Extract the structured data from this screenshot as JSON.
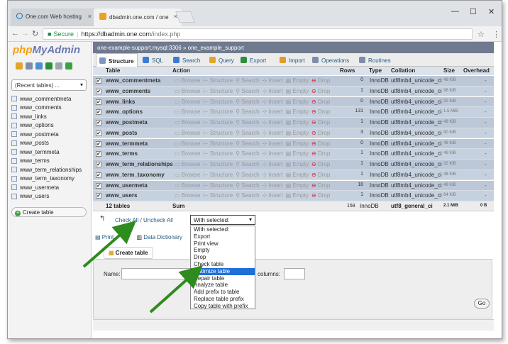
{
  "browser": {
    "tabs": [
      {
        "label": "One.com Web hosting"
      },
      {
        "label": "dbadmin.one.com / one"
      }
    ],
    "url": {
      "secure_label": "Secure",
      "host": "https://dbadmin.one.com",
      "path": "/index.php"
    }
  },
  "sidebar": {
    "logo_php": "php",
    "logo_myadmin": "MyAdmin",
    "recent_label": "(Recent tables) ...",
    "tables": [
      "www_commentmeta",
      "www_comments",
      "www_links",
      "www_options",
      "www_postmeta",
      "www_posts",
      "www_termmeta",
      "www_terms",
      "www_term_relationships",
      "www_term_taxonomy",
      "www_usermeta",
      "www_users"
    ],
    "create_table": "Create table"
  },
  "breadcrumb": {
    "server": "one-example-support.mysql:3306",
    "sep": "»",
    "db": "one_example_support"
  },
  "tabs": [
    "Structure",
    "SQL",
    "Search",
    "Query",
    "Export",
    "Import",
    "Operations",
    "Routines"
  ],
  "table_header": {
    "table": "Table",
    "action": "Action",
    "rows": "Rows",
    "type": "Type",
    "collation": "Collation",
    "size": "Size",
    "overhead": "Overhead"
  },
  "actions": {
    "browse": "Browse",
    "structure": "Structure",
    "search": "Search",
    "insert": "Insert",
    "empty": "Empty",
    "drop": "Drop"
  },
  "rows": [
    {
      "name": "www_commentmeta",
      "rows": "0",
      "type": "InnoDB",
      "collation": "utf8mb4_unicode_ci",
      "size": "48 KiB",
      "overhead": "-"
    },
    {
      "name": "www_comments",
      "rows": "1",
      "type": "InnoDB",
      "collation": "utf8mb4_unicode_ci",
      "size": "96 KiB",
      "overhead": "-"
    },
    {
      "name": "www_links",
      "rows": "0",
      "type": "InnoDB",
      "collation": "utf8mb4_unicode_ci",
      "size": "32 KiB",
      "overhead": "-"
    },
    {
      "name": "www_options",
      "rows": "131",
      "type": "InnoDB",
      "collation": "utf8mb4_unicode_ci",
      "size": "1.5 MiB",
      "overhead": "-"
    },
    {
      "name": "www_postmeta",
      "rows": "1",
      "type": "InnoDB",
      "collation": "utf8mb4_unicode_ci",
      "size": "48 KiB",
      "overhead": "-"
    },
    {
      "name": "www_posts",
      "rows": "3",
      "type": "InnoDB",
      "collation": "utf8mb4_unicode_ci",
      "size": "80 KiB",
      "overhead": "-"
    },
    {
      "name": "www_termmeta",
      "rows": "0",
      "type": "InnoDB",
      "collation": "utf8mb4_unicode_ci",
      "size": "48 KiB",
      "overhead": "-"
    },
    {
      "name": "www_terms",
      "rows": "1",
      "type": "InnoDB",
      "collation": "utf8mb4_unicode_ci",
      "size": "48 KiB",
      "overhead": "-"
    },
    {
      "name": "www_term_relationships",
      "rows": "1",
      "type": "InnoDB",
      "collation": "utf8mb4_unicode_ci",
      "size": "32 KiB",
      "overhead": "-"
    },
    {
      "name": "www_term_taxonomy",
      "rows": "1",
      "type": "InnoDB",
      "collation": "utf8mb4_unicode_ci",
      "size": "48 KiB",
      "overhead": "-"
    },
    {
      "name": "www_usermeta",
      "rows": "18",
      "type": "InnoDB",
      "collation": "utf8mb4_unicode_ci",
      "size": "48 KiB",
      "overhead": "-"
    },
    {
      "name": "www_users",
      "rows": "1",
      "type": "InnoDB",
      "collation": "utf8mb4_unicode_ci",
      "size": "64 KiB",
      "overhead": "-"
    }
  ],
  "summary": {
    "tables": "12 tables",
    "sum": "Sum",
    "rows": "158",
    "type": "InnoDB",
    "collation": "utf8_general_ci",
    "size": "2.1 MiB",
    "overhead": "0 B"
  },
  "check_all": "Check All / Uncheck All",
  "with_selected": "With selected:",
  "dropdown_options": [
    "With selected:",
    "Export",
    "Print view",
    "Empty",
    "Drop",
    "Check table",
    "Optimize table",
    "Repair table",
    "Analyze table",
    "Add prefix to table",
    "Replace table prefix",
    "Copy table with prefix"
  ],
  "highlighted_option": "Optimize table",
  "print_view": "Print view",
  "print_view_visible": "Print",
  "data_dictionary": "Data Dictionary",
  "create_table_section": {
    "legend": "Create table",
    "name_label": "Name:",
    "columns_label": "columns:",
    "go": "Go"
  },
  "colors": {
    "accent": "#235a81",
    "row": "#bcc8d8",
    "highlight": "#1e6fd9",
    "arrow": "#2e8b1e"
  }
}
